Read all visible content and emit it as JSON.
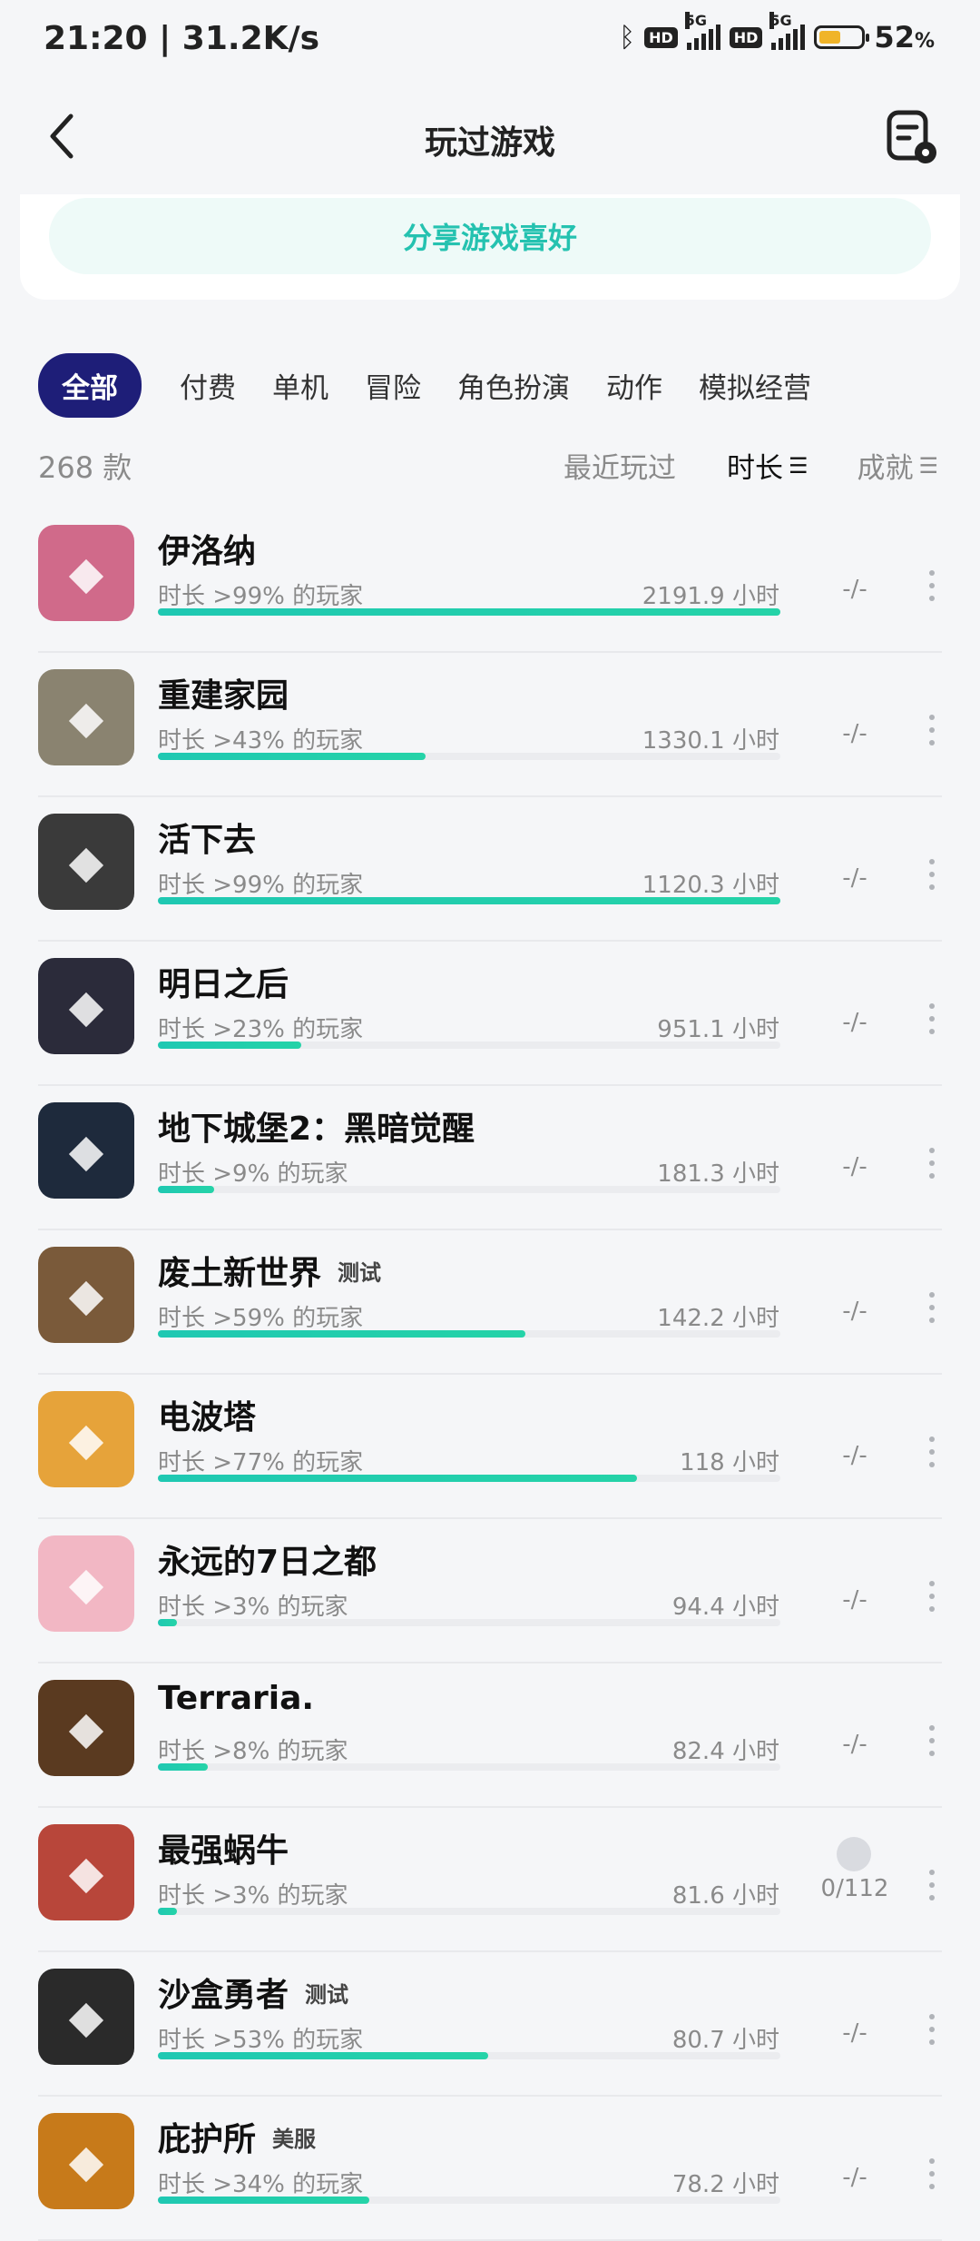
{
  "status_bar": {
    "time_speed": "21:20 | 31.2K/s",
    "battery_pct": "52",
    "battery_unit": "%",
    "battery_level": 0.52,
    "sig1": "5G",
    "sig2": "5G",
    "hd": "HD"
  },
  "header": {
    "title": "玩过游戏"
  },
  "share": {
    "label": "分享游戏喜好"
  },
  "tabs": [
    "全部",
    "付费",
    "单机",
    "冒险",
    "角色扮演",
    "动作",
    "模拟经营"
  ],
  "count_label": "268 款",
  "sorts": {
    "recent": "最近玩过",
    "duration": "时长",
    "achievement": "成就"
  },
  "games": [
    {
      "name": "伊洛纳",
      "badge": "",
      "desc": "时长 >99% 的玩家",
      "hours": "2191.9 小时",
      "progress": 1.0,
      "ach": "-/-",
      "color": "#d06a8a"
    },
    {
      "name": "重建家园",
      "badge": "",
      "desc": "时长 >43% 的玩家",
      "hours": "1330.1 小时",
      "progress": 0.43,
      "ach": "-/-",
      "color": "#8a8370"
    },
    {
      "name": "活下去",
      "badge": "",
      "desc": "时长 >99% 的玩家",
      "hours": "1120.3 小时",
      "progress": 1.0,
      "ach": "-/-",
      "color": "#3a3a3a"
    },
    {
      "name": "明日之后",
      "badge": "",
      "desc": "时长 >23% 的玩家",
      "hours": "951.1 小时",
      "progress": 0.23,
      "ach": "-/-",
      "color": "#2b2b3a"
    },
    {
      "name": "地下城堡2：黑暗觉醒",
      "badge": "",
      "desc": "时长 >9% 的玩家",
      "hours": "181.3 小时",
      "progress": 0.09,
      "ach": "-/-",
      "color": "#1e2a3c"
    },
    {
      "name": "废土新世界",
      "badge": "测试",
      "desc": "时长 >59% 的玩家",
      "hours": "142.2 小时",
      "progress": 0.59,
      "ach": "-/-",
      "color": "#7a5a3a"
    },
    {
      "name": "电波塔",
      "badge": "",
      "desc": "时长 >77% 的玩家",
      "hours": "118 小时",
      "progress": 0.77,
      "ach": "-/-",
      "color": "#e6a33a"
    },
    {
      "name": "永远的7日之都",
      "badge": "",
      "desc": "时长 >3% 的玩家",
      "hours": "94.4 小时",
      "progress": 0.03,
      "ach": "-/-",
      "color": "#f2b7c4"
    },
    {
      "name": "Terraria.",
      "badge": "",
      "desc": "时长 >8% 的玩家",
      "hours": "82.4 小时",
      "progress": 0.08,
      "ach": "-/-",
      "color": "#5a3a20"
    },
    {
      "name": "最强蜗牛",
      "badge": "",
      "desc": "时长 >3% 的玩家",
      "hours": "81.6 小时",
      "progress": 0.03,
      "ach": "0/112",
      "color": "#b8463a",
      "ach_icon": true
    },
    {
      "name": "沙盒勇者",
      "badge": "测试",
      "desc": "时长 >53% 的玩家",
      "hours": "80.7 小时",
      "progress": 0.53,
      "ach": "-/-",
      "color": "#2a2a2a"
    },
    {
      "name": "庇护所",
      "badge": "美服",
      "desc": "时长 >34% 的玩家",
      "hours": "78.2 小时",
      "progress": 0.34,
      "ach": "-/-",
      "color": "#c77a1a"
    }
  ]
}
